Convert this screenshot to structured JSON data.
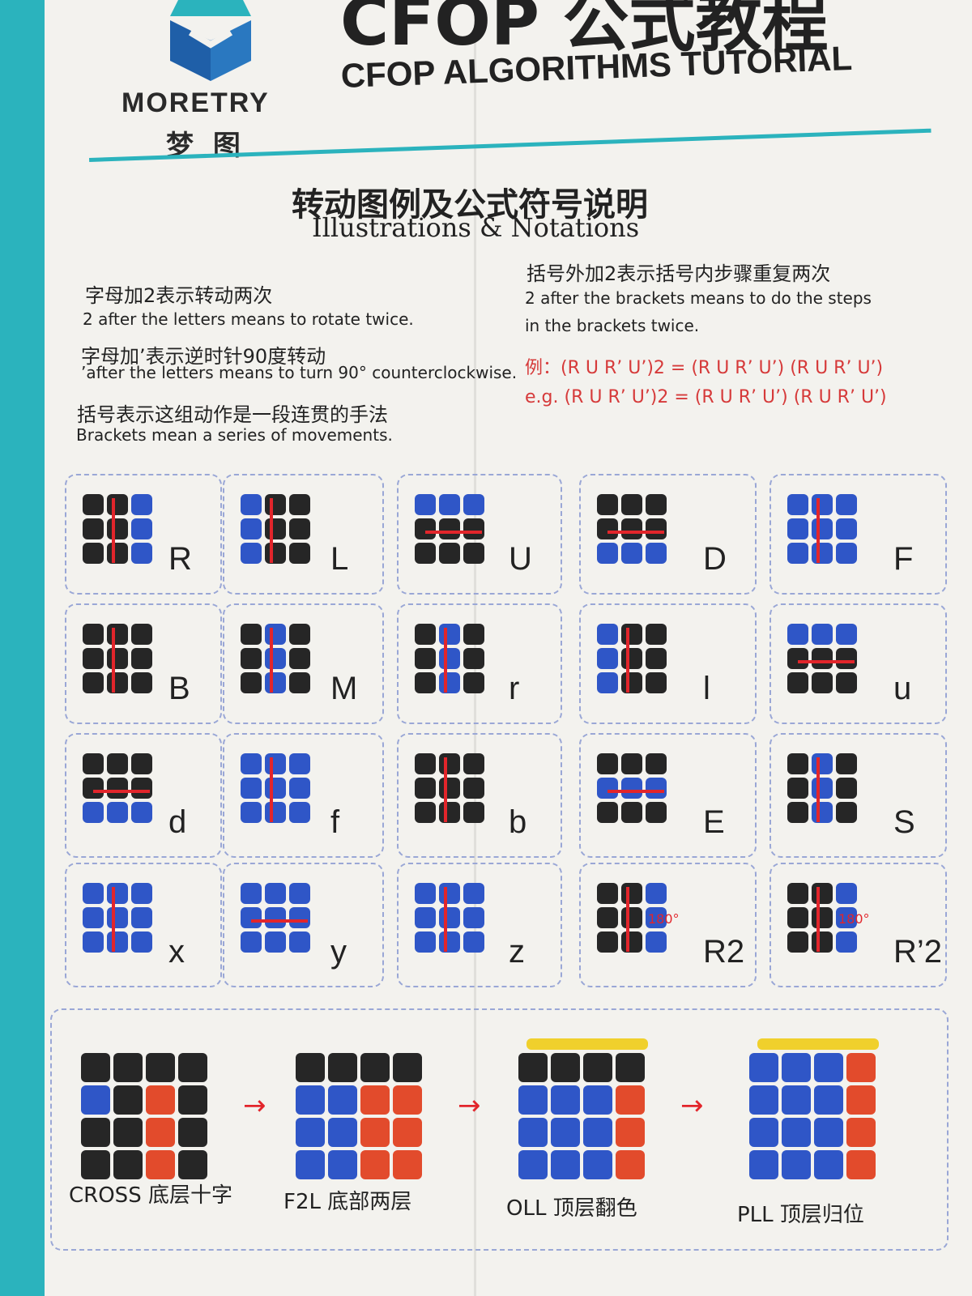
{
  "header": {
    "brand_en": "MORETRY",
    "brand_cn": "梦 图",
    "title_cn": "CFOP 公式教程",
    "title_en": "CFOP ALGORITHMS TUTORIAL"
  },
  "section": {
    "title_cn": "转动图例及公式符号说明",
    "title_en": "Illustrations & Notations"
  },
  "notes": [
    {
      "cn": "字母加2表示转动两次",
      "en": "2 after the letters means to rotate twice."
    },
    {
      "cn": "字母加’表示逆时针90度转动",
      "en": "’after the letters means to turn 90° counterclockwise."
    },
    {
      "cn": "括号表示这组动作是一段连贯的手法",
      "en": "Brackets mean a series of movements."
    }
  ],
  "notes_right": {
    "cn": "括号外加2表示括号内步骤重复两次",
    "en_line1": "2 after the brackets means to do the steps",
    "en_line2": "in the brackets twice.",
    "example_cn": "例：(R U R’ U’)2 = (R U R’ U’) (R U R’ U’)",
    "example_en": "e.g. (R U R’ U’)2 = (R U R’ U’) (R U R’ U’)"
  },
  "moves": [
    [
      "R",
      "L",
      "U",
      "D",
      "F"
    ],
    [
      "B",
      "M",
      "r",
      "l",
      "u"
    ],
    [
      "d",
      "f",
      "b",
      "E",
      "S"
    ],
    [
      "x",
      "y",
      "z",
      "R2",
      "R’2"
    ]
  ],
  "rotation_label": "180°",
  "steps": [
    "CROSS 底层十字",
    "F2L 底部两层",
    "OLL 顶层翻色",
    "PLL 顶层归位"
  ],
  "colors": {
    "teal": "#2bb3bd",
    "blue": "#2f56c7",
    "red": "#e2252b",
    "black": "#262626",
    "yellow": "#f0d02c"
  }
}
